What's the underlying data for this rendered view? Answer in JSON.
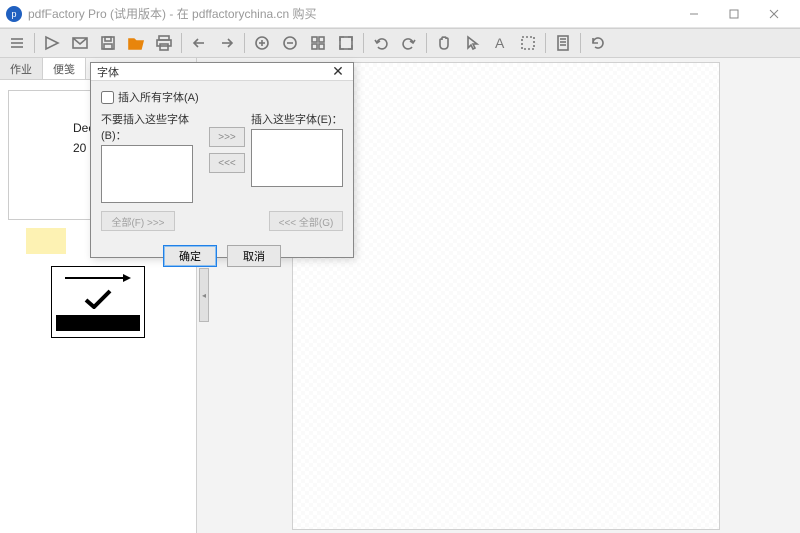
{
  "title": "pdfFactory Pro (试用版本) - 在 pdffactorychina.cn 购买",
  "tabs": {
    "jobs": "作业",
    "notes": "便笺"
  },
  "thumb": {
    "line1": "Decem",
    "line2": "20"
  },
  "dialog": {
    "title": "字体",
    "embed_all": "插入所有字体(A)",
    "exclude_label": "不要插入这些字体(B)：",
    "include_label": "插入这些字体(E)：",
    "move_right": ">>>",
    "move_left": "<<<",
    "all_right": "全部(F) >>>",
    "all_left": "<<< 全部(G)",
    "ok": "确定",
    "cancel": "取消"
  }
}
